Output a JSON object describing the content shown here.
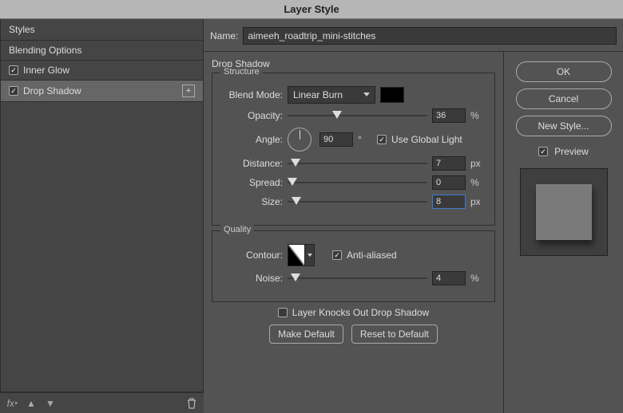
{
  "title": "Layer Style",
  "name_label": "Name:",
  "name_value": "aimeeh_roadtrip_mini-stitches",
  "sidebar": {
    "header": "Styles",
    "items": [
      {
        "label": "Blending Options",
        "checked": null
      },
      {
        "label": "Inner Glow",
        "checked": true
      },
      {
        "label": "Drop Shadow",
        "checked": true,
        "selected": true,
        "addable": true
      }
    ]
  },
  "panel_title": "Drop Shadow",
  "structure": {
    "legend": "Structure",
    "blend_mode_label": "Blend Mode:",
    "blend_mode_value": "Linear Burn",
    "opacity_label": "Opacity:",
    "opacity_value": "36",
    "opacity_unit": "%",
    "angle_label": "Angle:",
    "angle_value": "90",
    "angle_unit": "°",
    "global_light_label": "Use Global Light",
    "global_light_checked": true,
    "distance_label": "Distance:",
    "distance_value": "7",
    "distance_unit": "px",
    "spread_label": "Spread:",
    "spread_value": "0",
    "spread_unit": "%",
    "size_label": "Size:",
    "size_value": "8",
    "size_unit": "px"
  },
  "quality": {
    "legend": "Quality",
    "contour_label": "Contour:",
    "antialiased_label": "Anti-aliased",
    "antialiased_checked": true,
    "noise_label": "Noise:",
    "noise_value": "4",
    "noise_unit": "%"
  },
  "knockout_label": "Layer Knocks Out Drop Shadow",
  "knockout_checked": false,
  "make_default": "Make Default",
  "reset_default": "Reset to Default",
  "buttons": {
    "ok": "OK",
    "cancel": "Cancel",
    "newstyle": "New Style...",
    "preview": "Preview",
    "preview_checked": true
  },
  "colors": {
    "swatch": "#000000"
  }
}
